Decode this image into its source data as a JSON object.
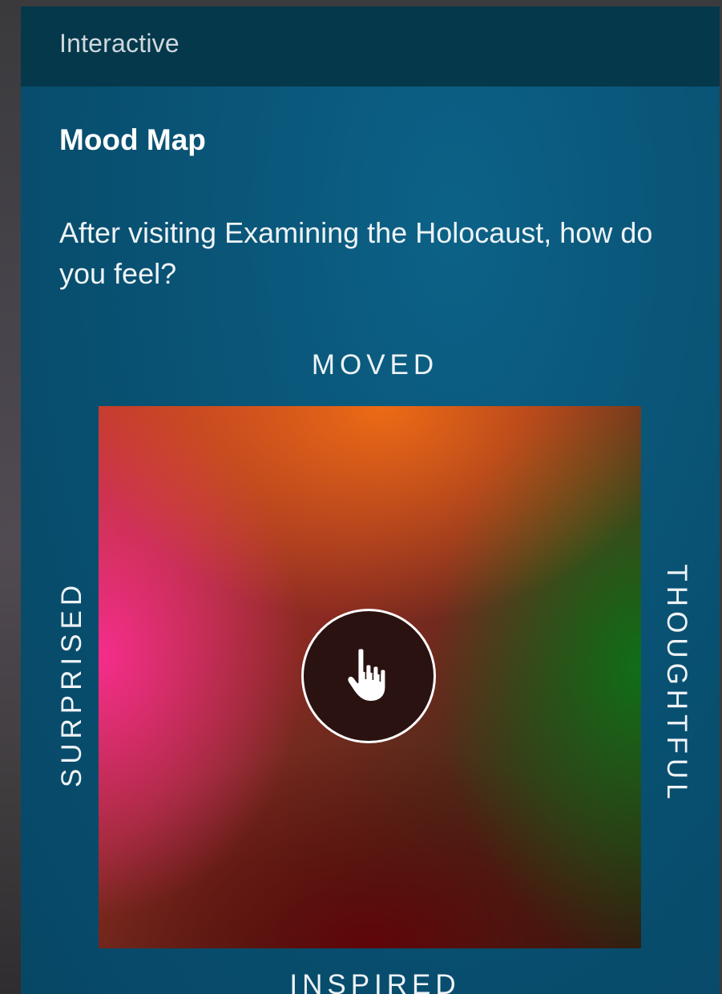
{
  "header": {
    "title": "Interactive"
  },
  "card": {
    "title": "Mood Map",
    "question": "After visiting Examining the Holocaust, how do you feel?"
  },
  "mood_map": {
    "top_label": "MOVED",
    "bottom_label": "INSPIRED",
    "left_label": "SURPRISED",
    "right_label": "THOUGHTFUL",
    "handle_icon": "pointing-hand-icon",
    "colors": {
      "moved": "#f06e14",
      "surprised": "#f52d8c",
      "thoughtful": "#106e18",
      "inspired": "#5f0508"
    }
  }
}
